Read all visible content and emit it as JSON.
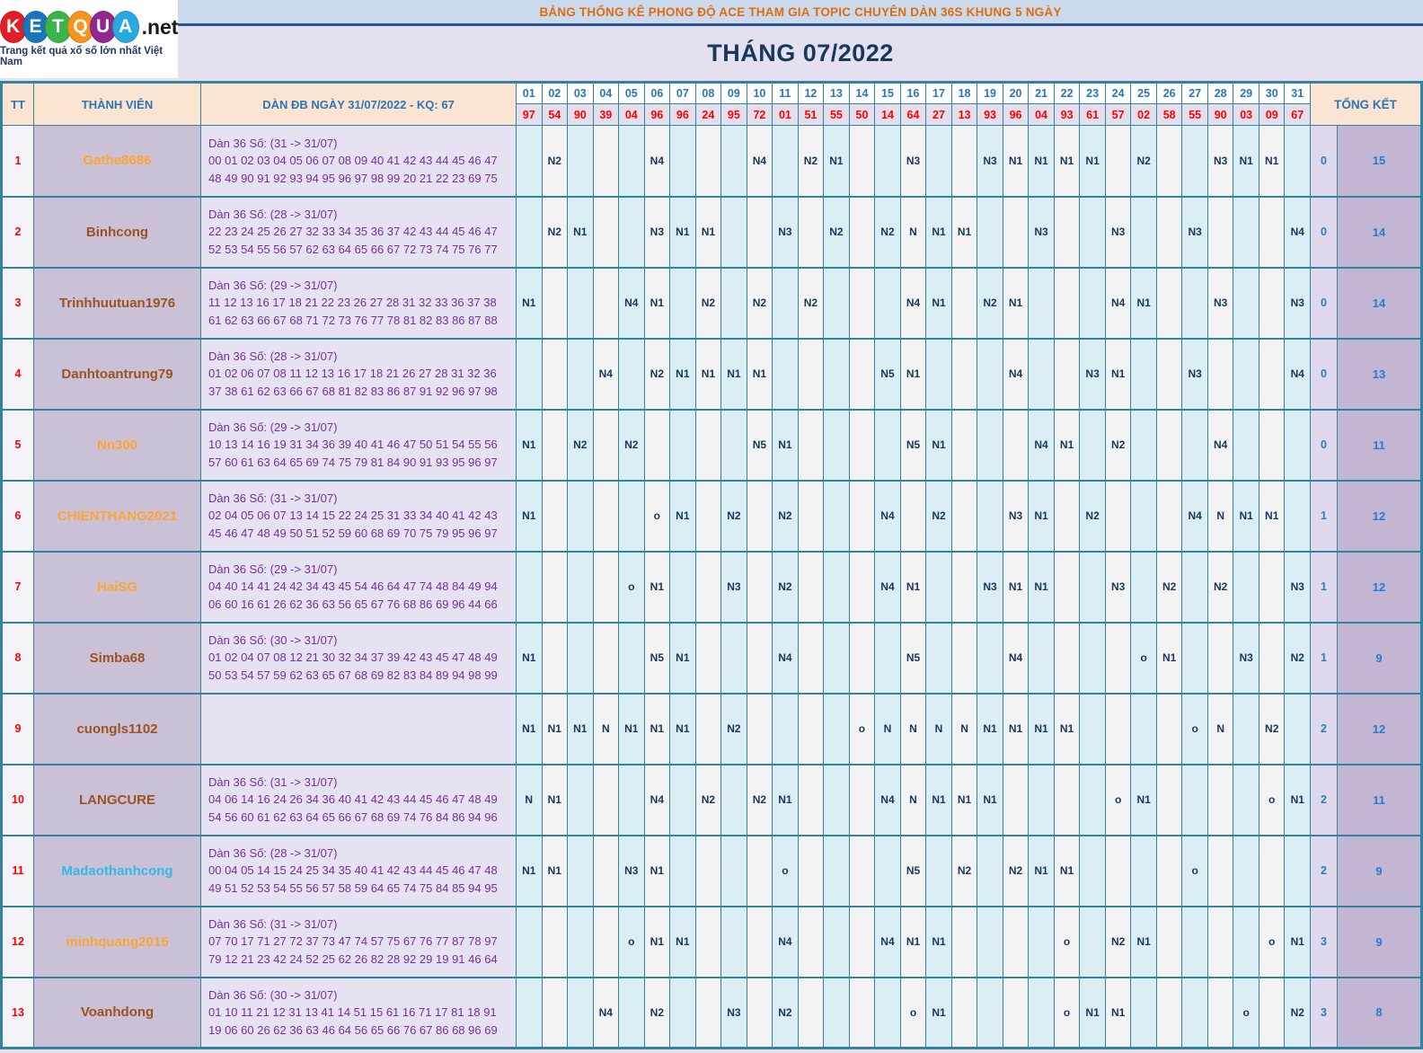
{
  "logo": {
    "letters": [
      {
        "ch": "K",
        "bg": "#E41E26"
      },
      {
        "ch": "E",
        "bg": "#1B75BB"
      },
      {
        "ch": "T",
        "bg": "#39B54A"
      },
      {
        "ch": "Q",
        "bg": "#F7941D"
      },
      {
        "ch": "U",
        "bg": "#92278F"
      },
      {
        "ch": "A",
        "bg": "#27AAE1"
      }
    ],
    "suffix": ".net",
    "tagline": "Trang kết quả xổ số lớn nhất Việt Nam"
  },
  "header": {
    "topic_title": "BẢNG THỐNG KÊ PHONG ĐỘ ACE THAM GIA TOPIC CHUYÊN DÀN 36S KHUNG 5 NGÀY",
    "month_title": "THÁNG 07/2022"
  },
  "table": {
    "col_tt": "TT",
    "col_member": "THÀNH VIÊN",
    "col_dan": "DÀN ĐB NGÀY 31/07/2022 - KQ: 67",
    "col_total": "TỔNG KẾT",
    "days": [
      "01",
      "02",
      "03",
      "04",
      "05",
      "06",
      "07",
      "08",
      "09",
      "10",
      "11",
      "12",
      "13",
      "14",
      "15",
      "16",
      "17",
      "18",
      "19",
      "20",
      "21",
      "22",
      "23",
      "24",
      "25",
      "26",
      "27",
      "28",
      "29",
      "30",
      "31"
    ],
    "results": [
      "97",
      "54",
      "90",
      "39",
      "04",
      "96",
      "96",
      "24",
      "95",
      "72",
      "01",
      "51",
      "55",
      "50",
      "14",
      "64",
      "27",
      "13",
      "93",
      "96",
      "04",
      "93",
      "61",
      "57",
      "02",
      "58",
      "55",
      "90",
      "03",
      "09",
      "67"
    ],
    "members": [
      {
        "tt": "1",
        "name": "Gathe8686",
        "color": "#FFA533",
        "dan_title": "Dàn 36 Số: (31 -> 31/07)",
        "dan_numbers": "00 01 02 03 04 05 06 07 08 09 40 41 42 43 44 45 46 47 48 49 90 91 92 93 94 95 96 97 98 99 20 21 22 23 69 75",
        "cells": {
          "2": "N2",
          "6": "N4",
          "10": "N4",
          "12": "N2",
          "13": "N1",
          "16": "N3",
          "19": "N3",
          "20": "N1",
          "21": "N1",
          "22": "N1",
          "23": "N1",
          "25": "N2",
          "28": "N3",
          "29": "N1",
          "30": "N1"
        },
        "total_miss": "0",
        "total_hit": "15"
      },
      {
        "tt": "2",
        "name": "Binhcong",
        "color": "#9C5220",
        "dan_title": "Dàn 36 Số: (28 -> 31/07)",
        "dan_numbers": "22 23 24 25 26 27 32 33 34 35 36 37 42 43 44 45 46 47 52 53 54 55 56 57 62 63 64 65 66 67 72 73 74 75 76 77",
        "cells": {
          "2": "N2",
          "3": "N1",
          "6": "N3",
          "7": "N1",
          "8": "N1",
          "11": "N3",
          "13": "N2",
          "15": "N2",
          "16": "N",
          "17": "N1",
          "18": "N1",
          "21": "N3",
          "24": "N3",
          "27": "N3",
          "31": "N4"
        },
        "total_miss": "0",
        "total_hit": "14"
      },
      {
        "tt": "3",
        "name": "Trinhhuutuan1976",
        "color": "#9C5220",
        "dan_title": "Dàn 36 Số: (29 -> 31/07)",
        "dan_numbers": "11 12 13 16 17 18 21 22 23 26 27 28 31 32 33 36 37 38 61 62 63 66 67 68 71 72 73 76 77 78 81 82 83 86 87 88",
        "cells": {
          "1": "N1",
          "5": "N4",
          "6": "N1",
          "8": "N2",
          "10": "N2",
          "12": "N2",
          "16": "N4",
          "17": "N1",
          "19": "N2",
          "20": "N1",
          "24": "N4",
          "25": "N1",
          "28": "N3",
          "31": "N3"
        },
        "total_miss": "0",
        "total_hit": "14"
      },
      {
        "tt": "4",
        "name": "Danhtoantrung79",
        "color": "#9C5220",
        "dan_title": "Dàn 36 Số: (28 -> 31/07)",
        "dan_numbers": "01 02 06 07 08 11 12 13 16 17 18 21 26 27 28 31 32 36 37 38 61 62 63 66 67 68 81 82 83 86 87 91 92 96 97 98",
        "cells": {
          "4": "N4",
          "6": "N2",
          "7": "N1",
          "8": "N1",
          "9": "N1",
          "10": "N1",
          "15": "N5",
          "16": "N1",
          "20": "N4",
          "23": "N3",
          "24": "N1",
          "27": "N3",
          "31": "N4"
        },
        "total_miss": "0",
        "total_hit": "13"
      },
      {
        "tt": "5",
        "name": "Nn300",
        "color": "#FFA533",
        "dan_title": "Dàn 36 Số: (29 -> 31/07)",
        "dan_numbers": "10 13 14 16 19 31 34 36 39 40 41 46 47 50 51 54 55 56 57 60 61 63 64 65 69 74 75 79 81 84 90 91 93 95 96 97",
        "cells": {
          "1": "N1",
          "3": "N2",
          "5": "N2",
          "10": "N5",
          "11": "N1",
          "16": "N5",
          "17": "N1",
          "21": "N4",
          "22": "N1",
          "24": "N2",
          "28": "N4"
        },
        "total_miss": "0",
        "total_hit": "11"
      },
      {
        "tt": "6",
        "name": "CHIENTHANG2021",
        "color": "#FFA533",
        "dan_title": "Dàn 36 Số: (31 -> 31/07)",
        "dan_numbers": "02 04 05 06 07 13 14 15 22 24 25 31 33 34 40 41 42 43 45 46 47 48 49 50 51 52 59 60 68 69 70 75 79 95 96 97",
        "cells": {
          "1": "N1",
          "6": "o",
          "7": "N1",
          "9": "N2",
          "11": "N2",
          "15": "N4",
          "17": "N2",
          "20": "N3",
          "21": "N1",
          "23": "N2",
          "27": "N4",
          "28": "N",
          "29": "N1",
          "30": "N1"
        },
        "total_miss": "1",
        "total_hit": "12"
      },
      {
        "tt": "7",
        "name": "HaiSG",
        "color": "#FFA533",
        "dan_title": "Dàn 36 Số: (29 -> 31/07)",
        "dan_numbers": "04 40 14 41 24 42 34 43 45 54 46 64 47 74 48 84 49 94 06 60 16 61 26 62 36 63 56 65 67 76 68 86 69 96 44 66",
        "cells": {
          "5": "o",
          "6": "N1",
          "9": "N3",
          "11": "N2",
          "15": "N4",
          "16": "N1",
          "19": "N3",
          "20": "N1",
          "21": "N1",
          "24": "N3",
          "26": "N2",
          "28": "N2",
          "31": "N3"
        },
        "total_miss": "1",
        "total_hit": "12"
      },
      {
        "tt": "8",
        "name": "Simba68",
        "color": "#9C5220",
        "dan_title": "Dàn 36 Số: (30 -> 31/07)",
        "dan_numbers": "01 02 04 07 08 12 21 30 32 34 37 39 42 43 45 47 48 49 50 53 54 57 59 62 63 65 67 68 69 82 83 84 89 94 98 99",
        "cells": {
          "1": "N1",
          "6": "N5",
          "7": "N1",
          "11": "N4",
          "16": "N5",
          "20": "N4",
          "25": "o",
          "26": "N1",
          "29": "N3",
          "31": "N2"
        },
        "total_miss": "1",
        "total_hit": "9"
      },
      {
        "tt": "9",
        "name": "cuongls1102",
        "color": "#9C5220",
        "dan_title": "",
        "dan_numbers": "",
        "cells": {
          "1": "N1",
          "2": "N1",
          "3": "N1",
          "4": "N",
          "5": "N1",
          "6": "N1",
          "7": "N1",
          "9": "N2",
          "14": "o",
          "15": "N",
          "16": "N",
          "17": "N",
          "18": "N",
          "19": "N1",
          "20": "N1",
          "21": "N1",
          "22": "N1",
          "27": "o",
          "28": "N",
          "30": "N2"
        },
        "total_miss": "2",
        "total_hit": "12"
      },
      {
        "tt": "10",
        "name": "LANGCURE",
        "color": "#9C5220",
        "dan_title": "Dàn 36 Số: (31 -> 31/07)",
        "dan_numbers": "04 06 14 16 24 26 34 36 40 41 42 43 44 45 46 47 48 49 54 56 60 61 62 63 64 65 66 67 68 69 74 76 84 86 94 96",
        "cells": {
          "1": "N",
          "2": "N1",
          "6": "N4",
          "8": "N2",
          "10": "N2",
          "11": "N1",
          "15": "N4",
          "16": "N",
          "17": "N1",
          "18": "N1",
          "19": "N1",
          "24": "o",
          "25": "N1",
          "30": "o",
          "31": "N1"
        },
        "total_miss": "2",
        "total_hit": "11"
      },
      {
        "tt": "11",
        "name": "Madaothanhcong",
        "color": "#33B8E8",
        "dan_title": "Dàn 36 Số: (28 -> 31/07)",
        "dan_numbers": "00 04 05 14 15 24 25 34 35 40 41 42 43 44 45 46 47 48 49 51 52 53 54 55 56 57 58 59 64 65 74 75 84 85 94 95",
        "cells": {
          "1": "N1",
          "2": "N1",
          "5": "N3",
          "6": "N1",
          "11": "o",
          "16": "N5",
          "18": "N2",
          "20": "N2",
          "21": "N1",
          "22": "N1",
          "27": "o"
        },
        "total_miss": "2",
        "total_hit": "9"
      },
      {
        "tt": "12",
        "name": "minhquang2015",
        "color": "#FFA533",
        "dan_title": "Dàn 36 Số: (31 -> 31/07)",
        "dan_numbers": "07 70 17 71 27 72 37 73 47 74 57 75 67 76 77 87 78 97 79 12 21 23 42 24 52 25 62 26 82 28 92 29 19 91 46 64",
        "cells": {
          "5": "o",
          "6": "N1",
          "7": "N1",
          "11": "N4",
          "15": "N4",
          "16": "N1",
          "17": "N1",
          "22": "o",
          "24": "N2",
          "25": "N1",
          "30": "o",
          "31": "N1"
        },
        "total_miss": "3",
        "total_hit": "9"
      },
      {
        "tt": "13",
        "name": "Voanhdong",
        "color": "#9C5220",
        "dan_title": "Dàn 36 Số: (30 -> 31/07)",
        "dan_numbers": "01 10 11 21 12 31 13 41 14 51 15 61 16 71 17 81 18 91 19 06 60 26 62 36 63 46 64 56 65 66 76 67 86 68 96 69",
        "cells": {
          "4": "N4",
          "6": "N2",
          "9": "N3",
          "11": "N2",
          "16": "o",
          "17": "N1",
          "22": "o",
          "23": "N1",
          "24": "N1",
          "29": "o",
          "31": "N2"
        },
        "total_miss": "3",
        "total_hit": "8"
      }
    ]
  },
  "colors": {
    "border_teal": "#31849B",
    "odd_day_bg": "#DAEEF3",
    "even_day_bg": "#F3F3F3",
    "header_peach": "#FBE5D2",
    "result_red": "#FF0000",
    "header_blue": "#2E75B6",
    "cell_navy": "#17375E",
    "dan_purple": "#7030A0",
    "title_orange": "#E26B0A"
  }
}
